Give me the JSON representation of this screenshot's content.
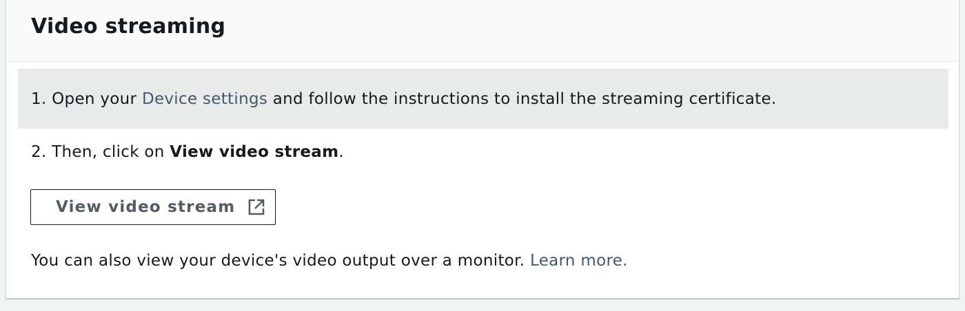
{
  "panel": {
    "title": "Video streaming"
  },
  "step1": {
    "prefix": "1. Open your ",
    "link": "Device settings",
    "suffix": " and follow the instructions to install the streaming certificate."
  },
  "step2": {
    "prefix": "2. Then, click on ",
    "bold": "View video stream",
    "suffix": "."
  },
  "button": {
    "label": "View video stream",
    "icon": "external-link-icon"
  },
  "note": {
    "text": "You can also view your device's video output over a monitor. ",
    "link": "Learn more."
  },
  "colors": {
    "link": "#44596f",
    "step_background": "#e9ebeb",
    "button_text": "#545b64"
  }
}
